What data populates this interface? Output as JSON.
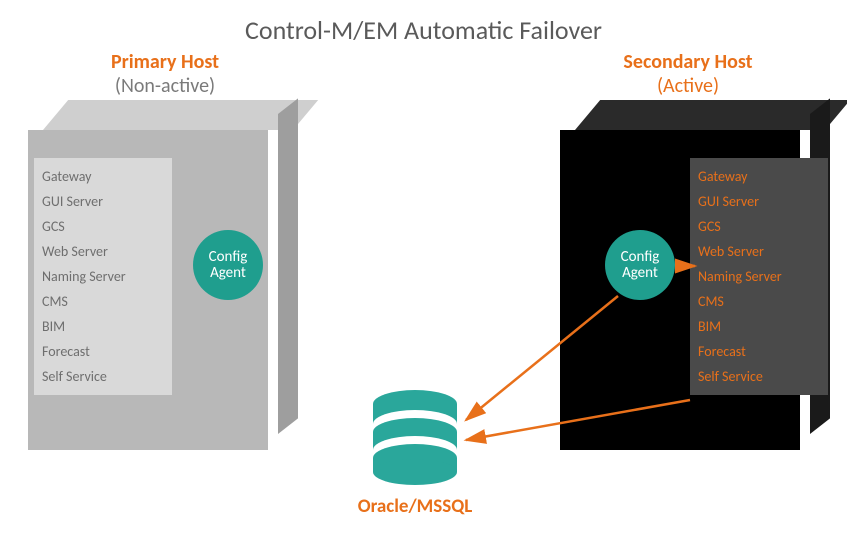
{
  "title": "Control-M/EM Automatic Failover",
  "primary": {
    "label": "Primary Host",
    "status": "(Non-active)",
    "agent": "Config Agent",
    "services": [
      "Gateway",
      "GUI Server",
      "GCS",
      "Web Server",
      "Naming Server",
      "CMS",
      "BIM",
      "Forecast",
      "Self Service"
    ]
  },
  "secondary": {
    "label": "Secondary Host",
    "status": "(Active)",
    "agent": "Config Agent",
    "services": [
      "Gateway",
      "GUI Server",
      "GCS",
      "Web Server",
      "Naming Server",
      "CMS",
      "BIM",
      "Forecast",
      "Self Service"
    ]
  },
  "database": "Oracle/MSSQL",
  "colors": {
    "accent": "#e8701a",
    "teal": "#1f9e8e"
  }
}
